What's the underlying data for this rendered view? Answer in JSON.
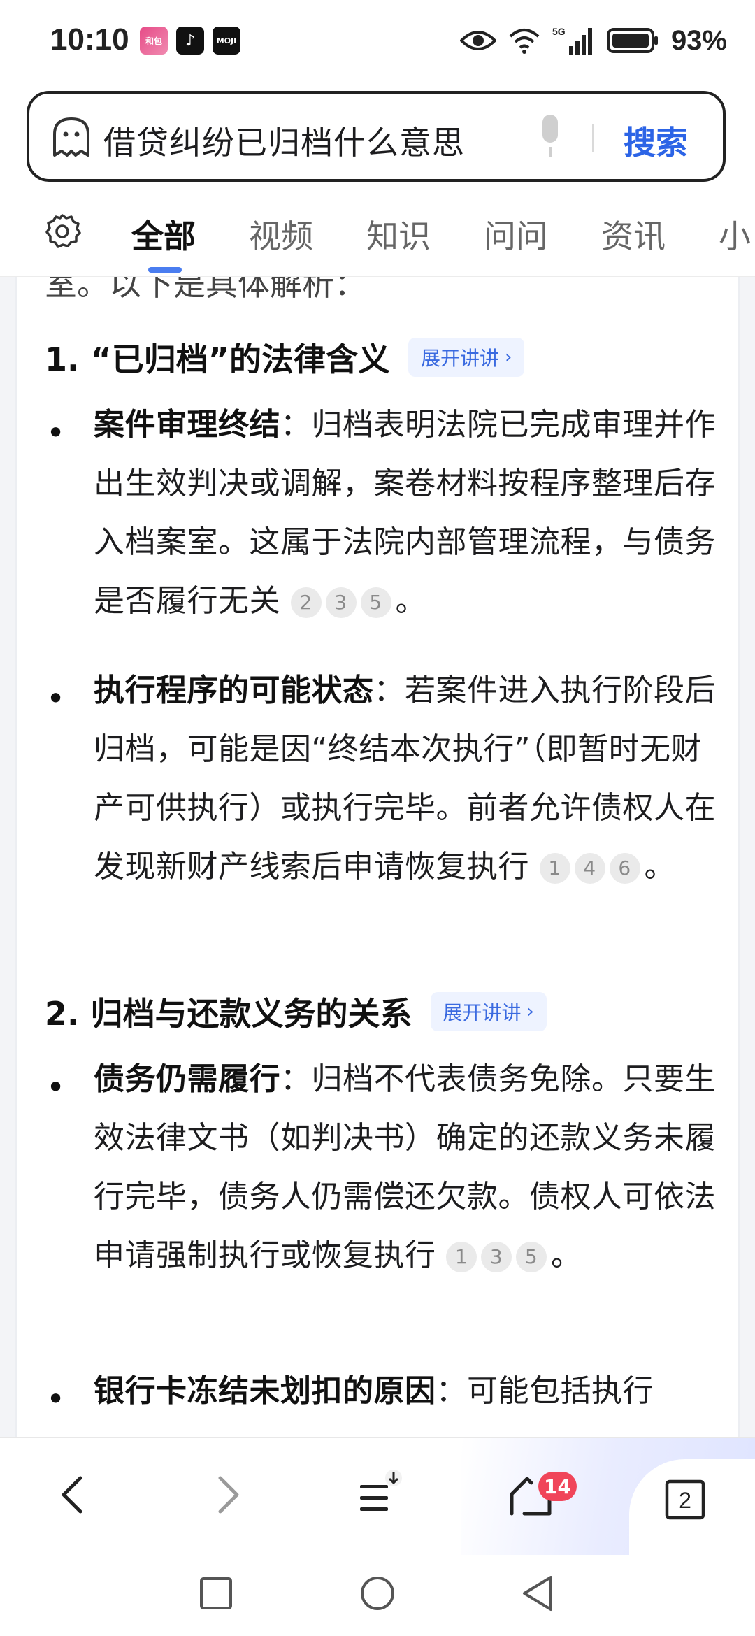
{
  "status_bar": {
    "time": "10:10",
    "app_icons": [
      "和包",
      "抖音",
      "墨迹天气"
    ],
    "battery_percent": "93%",
    "network": "5G"
  },
  "search": {
    "query": "借贷纠纷已归档什么意思",
    "button_label": "搜索"
  },
  "tabs": [
    {
      "label": "全部",
      "active": true
    },
    {
      "label": "视频",
      "active": false
    },
    {
      "label": "知识",
      "active": false
    },
    {
      "label": "问问",
      "active": false
    },
    {
      "label": "资讯",
      "active": false
    },
    {
      "label": "小",
      "active": false
    }
  ],
  "content": {
    "cut_text": "室。以下是具体解析：",
    "expand_label": "展开讲讲",
    "sections": [
      {
        "heading": "1. “已归档”的法律含义",
        "items": [
          {
            "title": "案件审理终结",
            "text": "：归档表明法院已完成审理并作出生效判决或调解，案卷材料按程序整理后存入档案室。这属于法院内部管理流程，与债务是否履行无关",
            "citations": [
              "2",
              "3",
              "5"
            ],
            "tail": "。"
          },
          {
            "title": "执行程序的可能状态",
            "text": "：若案件进入执行阶段后归档，可能是因“终结本次执行”（即暂时无财产可供执行）或执行完毕。前者允许债权人在发现新财产线索后申请恢复执行",
            "citations": [
              "1",
              "4",
              "6"
            ],
            "tail": "。"
          }
        ]
      },
      {
        "heading": "2. 归档与还款义务的关系",
        "items": [
          {
            "title": "债务仍需履行",
            "text": "：归档不代表债务免除。只要生效法律文书（如判决书）确定的还款义务未履行完毕，债务人仍需偿还欠款。债权人可依法申请强制执行或恢复执行",
            "citations": [
              "1",
              "3",
              "5"
            ],
            "tail": "。"
          },
          {
            "title": "银行卡冻结未划扣的原因",
            "text": "：可能包括执行",
            "citations": [],
            "tail": ""
          }
        ]
      }
    ]
  },
  "browser_bar": {
    "notification_count": "14",
    "tab_count": "2"
  },
  "colors": {
    "accent": "#2c64e6",
    "badge": "#f0455a",
    "expand_bg": "#eef3ff"
  }
}
